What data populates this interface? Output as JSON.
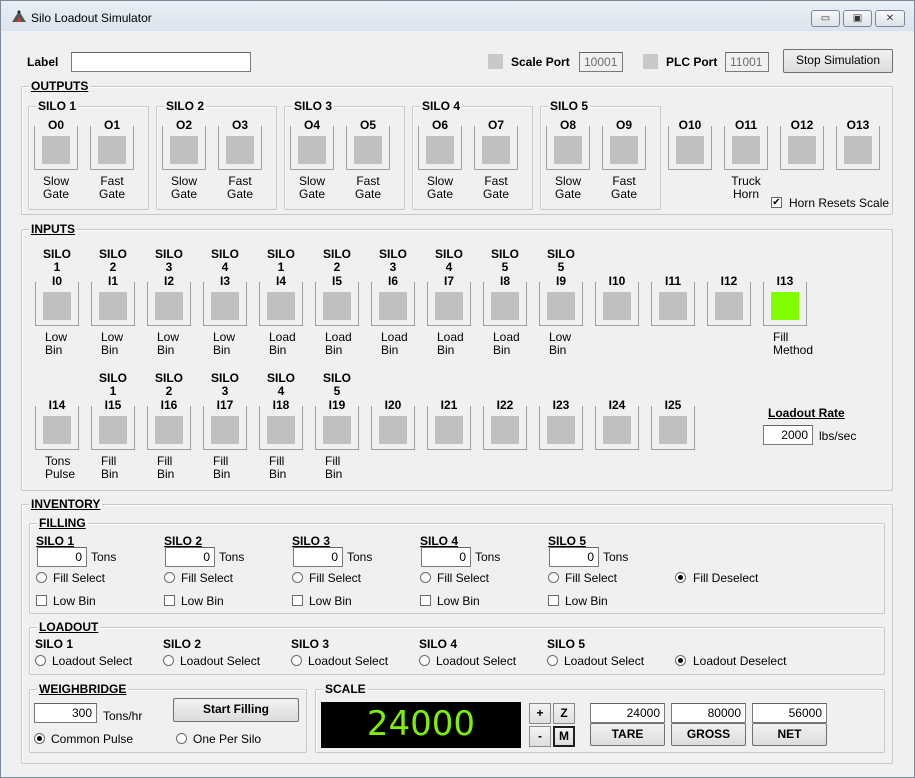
{
  "window": {
    "title": "Silo Loadout Simulator",
    "controls": {
      "minimize": "▭",
      "maximize": "▣",
      "close": "✕"
    }
  },
  "top": {
    "label_caption": "Label",
    "label_value": "",
    "scale_port_label": "Scale Port",
    "scale_port_value": "10001",
    "plc_port_label": "PLC Port",
    "plc_port_value": "11001",
    "stop_button": "Stop Simulation"
  },
  "outputs": {
    "title": "OUTPUTS",
    "silos": [
      {
        "name": "SILO 1",
        "items": [
          {
            "code": "O0",
            "l1": "Slow",
            "l2": "Gate"
          },
          {
            "code": "O1",
            "l1": "Fast",
            "l2": "Gate"
          }
        ]
      },
      {
        "name": "SILO 2",
        "items": [
          {
            "code": "O2",
            "l1": "Slow",
            "l2": "Gate"
          },
          {
            "code": "O3",
            "l1": "Fast",
            "l2": "Gate"
          }
        ]
      },
      {
        "name": "SILO 3",
        "items": [
          {
            "code": "O4",
            "l1": "Slow",
            "l2": "Gate"
          },
          {
            "code": "O5",
            "l1": "Fast",
            "l2": "Gate"
          }
        ]
      },
      {
        "name": "SILO 4",
        "items": [
          {
            "code": "O6",
            "l1": "Slow",
            "l2": "Gate"
          },
          {
            "code": "O7",
            "l1": "Fast",
            "l2": "Gate"
          }
        ]
      },
      {
        "name": "SILO 5",
        "items": [
          {
            "code": "O8",
            "l1": "Slow",
            "l2": "Gate"
          },
          {
            "code": "O9",
            "l1": "Fast",
            "l2": "Gate"
          }
        ]
      }
    ],
    "extra": [
      {
        "code": "O10",
        "l1": "",
        "l2": ""
      },
      {
        "code": "O11",
        "l1": "Truck",
        "l2": "Horn"
      },
      {
        "code": "O12",
        "l1": "",
        "l2": ""
      },
      {
        "code": "O13",
        "l1": "",
        "l2": ""
      }
    ],
    "horn_resets_scale": "Horn Resets Scale",
    "horn_resets_checked": "✔"
  },
  "inputs": {
    "title": "INPUTS",
    "row1": [
      {
        "h1": "SILO",
        "h2": "1",
        "code": "I0",
        "l1": "Low",
        "l2": "Bin",
        "on": false
      },
      {
        "h1": "SILO",
        "h2": "2",
        "code": "I1",
        "l1": "Low",
        "l2": "Bin",
        "on": false
      },
      {
        "h1": "SILO",
        "h2": "3",
        "code": "I2",
        "l1": "Low",
        "l2": "Bin",
        "on": false
      },
      {
        "h1": "SILO",
        "h2": "4",
        "code": "I3",
        "l1": "Low",
        "l2": "Bin",
        "on": false
      },
      {
        "h1": "SILO",
        "h2": "1",
        "code": "I4",
        "l1": "Load",
        "l2": "Bin",
        "on": false
      },
      {
        "h1": "SILO",
        "h2": "2",
        "code": "I5",
        "l1": "Load",
        "l2": "Bin",
        "on": false
      },
      {
        "h1": "SILO",
        "h2": "3",
        "code": "I6",
        "l1": "Load",
        "l2": "Bin",
        "on": false
      },
      {
        "h1": "SILO",
        "h2": "4",
        "code": "I7",
        "l1": "Load",
        "l2": "Bin",
        "on": false
      },
      {
        "h1": "SILO",
        "h2": "5",
        "code": "I8",
        "l1": "Load",
        "l2": "Bin",
        "on": false
      },
      {
        "h1": "SILO",
        "h2": "5",
        "code": "I9",
        "l1": "Low",
        "l2": "Bin",
        "on": false
      },
      {
        "h1": "",
        "h2": "",
        "code": "I10",
        "l1": "",
        "l2": "",
        "on": false
      },
      {
        "h1": "",
        "h2": "",
        "code": "I11",
        "l1": "",
        "l2": "",
        "on": false
      },
      {
        "h1": "",
        "h2": "",
        "code": "I12",
        "l1": "",
        "l2": "",
        "on": false
      },
      {
        "h1": "",
        "h2": "",
        "code": "I13",
        "l1": "Fill",
        "l2": "Method",
        "on": true
      }
    ],
    "row2": [
      {
        "h1": "",
        "h2": "",
        "code": "I14",
        "l1": "Tons",
        "l2": "Pulse"
      },
      {
        "h1": "SILO",
        "h2": "1",
        "code": "I15",
        "l1": "Fill",
        "l2": "Bin"
      },
      {
        "h1": "SILO",
        "h2": "2",
        "code": "I16",
        "l1": "Fill",
        "l2": "Bin"
      },
      {
        "h1": "SILO",
        "h2": "3",
        "code": "I17",
        "l1": "Fill",
        "l2": "Bin"
      },
      {
        "h1": "SILO",
        "h2": "4",
        "code": "I18",
        "l1": "Fill",
        "l2": "Bin"
      },
      {
        "h1": "SILO",
        "h2": "5",
        "code": "I19",
        "l1": "Fill",
        "l2": "Bin"
      },
      {
        "h1": "",
        "h2": "",
        "code": "I20",
        "l1": "",
        "l2": ""
      },
      {
        "h1": "",
        "h2": "",
        "code": "I21",
        "l1": "",
        "l2": ""
      },
      {
        "h1": "",
        "h2": "",
        "code": "I22",
        "l1": "",
        "l2": ""
      },
      {
        "h1": "",
        "h2": "",
        "code": "I23",
        "l1": "",
        "l2": ""
      },
      {
        "h1": "",
        "h2": "",
        "code": "I24",
        "l1": "",
        "l2": ""
      },
      {
        "h1": "",
        "h2": "",
        "code": "I25",
        "l1": "",
        "l2": ""
      }
    ],
    "loadout_rate_label": "Loadout Rate",
    "loadout_rate_value": "2000",
    "loadout_rate_unit": "lbs/sec",
    "active_color": "#80ff00",
    "inactive_color": "#c0c0c0"
  },
  "inventory": {
    "title": "INVENTORY",
    "filling": {
      "title": "FILLING",
      "silos": [
        {
          "name": "SILO 1",
          "tons": "0",
          "fill_select": "Fill Select",
          "low_bin": "Low Bin"
        },
        {
          "name": "SILO 2",
          "tons": "0",
          "fill_select": "Fill Select",
          "low_bin": "Low Bin"
        },
        {
          "name": "SILO 3",
          "tons": "0",
          "fill_select": "Fill Select",
          "low_bin": "Low Bin"
        },
        {
          "name": "SILO 4",
          "tons": "0",
          "fill_select": "Fill Select",
          "low_bin": "Low Bin"
        },
        {
          "name": "SILO 5",
          "tons": "0",
          "fill_select": "Fill Select",
          "low_bin": "Low Bin"
        }
      ],
      "tons_unit": "Tons",
      "deselect": "Fill Deselect",
      "selected": "deselect"
    },
    "loadout": {
      "title": "LOADOUT",
      "silos": [
        {
          "name": "SILO 1",
          "select": "Loadout Select"
        },
        {
          "name": "SILO 2",
          "select": "Loadout Select"
        },
        {
          "name": "SILO 3",
          "select": "Loadout Select"
        },
        {
          "name": "SILO 4",
          "select": "Loadout Select"
        },
        {
          "name": "SILO 5",
          "select": "Loadout Select"
        }
      ],
      "deselect": "Loadout Deselect",
      "selected": "deselect"
    },
    "weighbridge": {
      "title": "WEIGHBRIDGE",
      "rate_value": "300",
      "rate_unit": "Tons/hr",
      "start_button": "Start Filling",
      "common_pulse": "Common Pulse",
      "one_per_silo": "One Per Silo",
      "selected": "common_pulse"
    },
    "scale": {
      "title": "SCALE",
      "display": "24000",
      "plus": "+",
      "minus": "-",
      "z": "Z",
      "m": "M",
      "tare_value": "24000",
      "gross_value": "80000",
      "net_value": "56000",
      "tare_button": "TARE",
      "gross_button": "GROSS",
      "net_button": "NET"
    }
  }
}
